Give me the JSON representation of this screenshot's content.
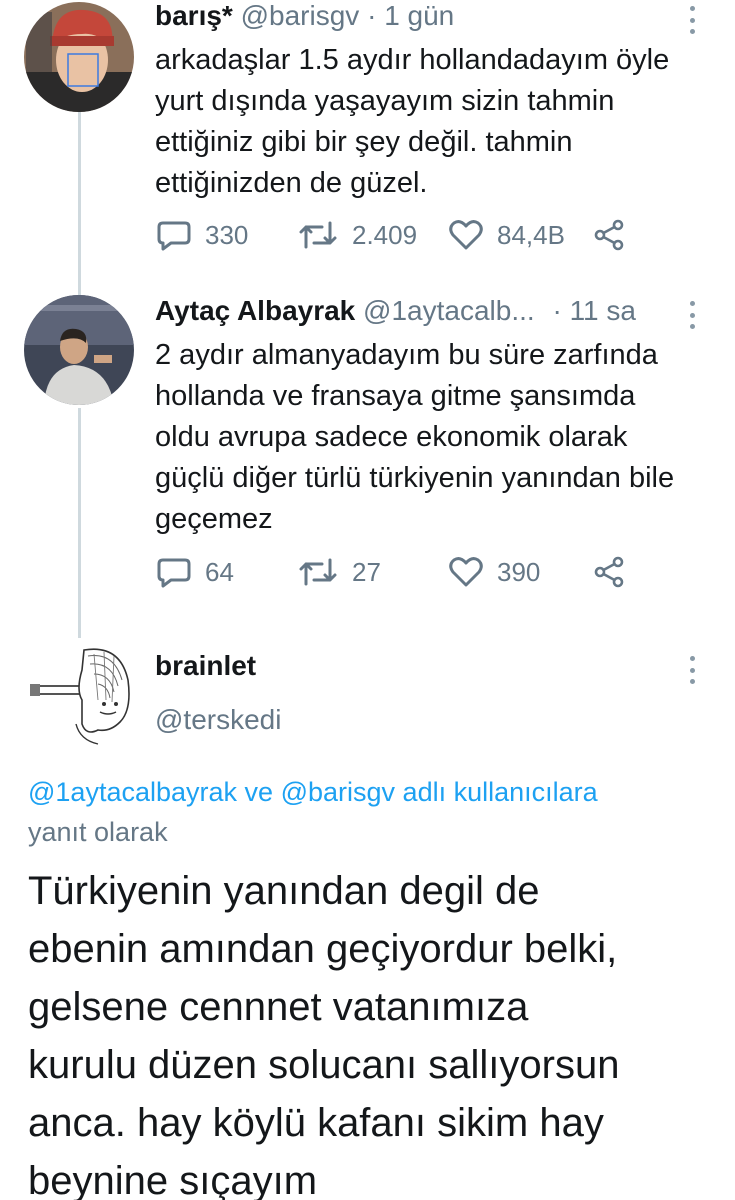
{
  "tweets": [
    {
      "name": "barış*",
      "handle": "@barisgv",
      "dot": "·",
      "time": "1 gün",
      "lines": [
        "arkadaşlar 1.5 aydır hollandadayım öyle",
        "yurt dışında yaşayayım sizin tahmin",
        "ettiğiniz gibi bir şey değil. tahmin",
        "ettiğinizden de güzel."
      ],
      "reply_count": "330",
      "retweet_count": "2.409",
      "like_count": "84,4B"
    },
    {
      "name": "Aytaç Albayrak",
      "handle": "@1aytacalb...",
      "dot": "·",
      "time": "11 sa",
      "lines": [
        "2 aydır  almanyadayım bu süre zarfında",
        "hollanda ve fransaya gitme şansımda",
        "oldu avrupa sadece ekonomik olarak",
        "güçlü diğer türlü türkiyenin yanından bile",
        "geçemez"
      ],
      "reply_count": "64",
      "retweet_count": "27",
      "like_count": "390"
    }
  ],
  "focused": {
    "name": "brainlet",
    "handle": "@terskedi",
    "reply_prefix_mention1": "@1aytacalbayrak",
    "reply_and": "ve",
    "reply_prefix_mention2": "@barisgv",
    "reply_suffix": "adlı kullanıcılara",
    "reply_suffix2": "yanıt olarak",
    "lines": [
      "Türkiyenin yanından degil de",
      "ebenin amından geçiyordur belki,",
      "gelsene cennnet vatanımıza",
      "kurulu düzen solucanı sallıyorsun",
      "anca. hay köylü kafanı sikim hay",
      "beynine sıçayım"
    ]
  },
  "icons": {
    "reply": "speech-bubble-icon",
    "retweet": "retweet-arrows-icon",
    "like": "heart-icon",
    "share": "share-icon",
    "more": "vertical-dots-icon"
  },
  "colors": {
    "text": "#14171a",
    "muted": "#657786",
    "link": "#1da1f2",
    "thread_line": "#cfd9de"
  }
}
